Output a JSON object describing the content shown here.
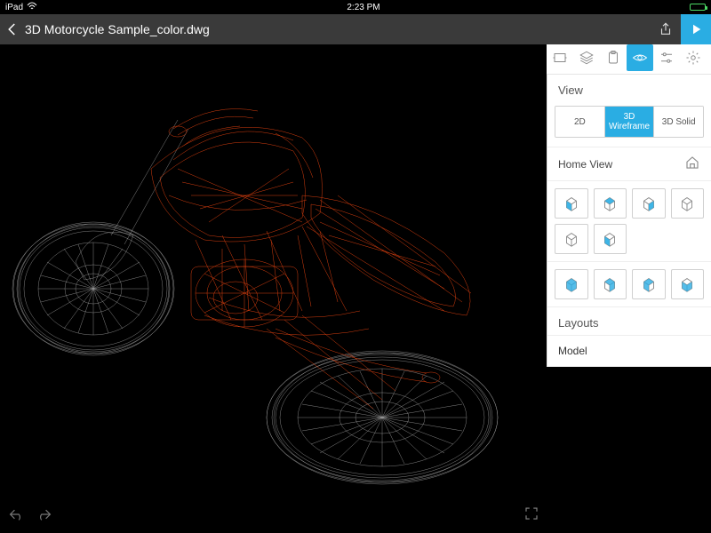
{
  "statusbar": {
    "device": "iPad",
    "time": "2:23 PM",
    "battery_pct": 90
  },
  "header": {
    "filename": "3D Motorcycle Sample_color.dwg"
  },
  "tools": [
    {
      "name": "fit-view-icon",
      "active": false
    },
    {
      "name": "layers-icon",
      "active": false
    },
    {
      "name": "clipboard-icon",
      "active": false
    },
    {
      "name": "eye-icon",
      "active": true
    },
    {
      "name": "settings-sliders-icon",
      "active": false
    },
    {
      "name": "gear-icon",
      "active": false
    }
  ],
  "panel": {
    "view_title": "View",
    "modes": [
      {
        "label": "2D",
        "active": false
      },
      {
        "label": "3D Wireframe",
        "active": true
      },
      {
        "label": "3D Solid",
        "active": false
      }
    ],
    "home_view_label": "Home View",
    "layouts_title": "Layouts",
    "layouts": [
      "Model"
    ]
  },
  "colors": {
    "accent": "#2AADE3",
    "wire_primary": "#ff4a12",
    "wire_secondary": "#dcdcdc"
  }
}
